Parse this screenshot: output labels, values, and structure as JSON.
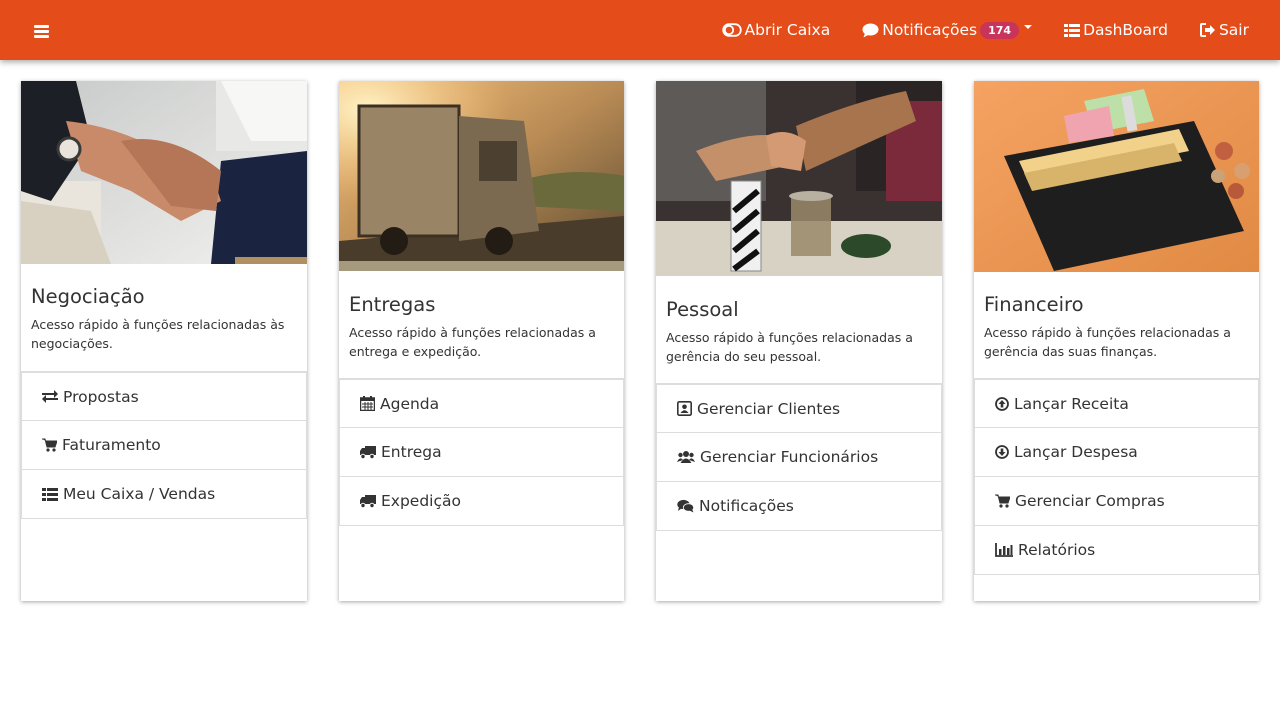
{
  "navbar": {
    "bg_color": "#e44c1a",
    "abrir_caixa": "Abrir Caixa",
    "notificacoes": "Notificações",
    "notif_count": "174",
    "dashboard": "DashBoard",
    "sair": "Sair"
  },
  "cards": [
    {
      "title": "Negociação",
      "text": "Acesso rápido à funções relacionadas às negociações.",
      "image": "handshake-photo",
      "items": [
        {
          "label": "Propostas",
          "icon": "exchange-icon"
        },
        {
          "label": "Faturamento",
          "icon": "cart-icon"
        },
        {
          "label": "Meu Caixa / Vendas",
          "icon": "list-icon"
        }
      ]
    },
    {
      "title": "Entregas",
      "text": "Acesso rápido à funções relacionadas a entrega e expedição.",
      "image": "truck-photo",
      "items": [
        {
          "label": "Agenda",
          "icon": "calendar-icon"
        },
        {
          "label": "Entrega",
          "icon": "truck-icon"
        },
        {
          "label": "Expedição",
          "icon": "truck-icon"
        }
      ]
    },
    {
      "title": "Pessoal",
      "text": "Acesso rápido à funções relacionadas a gerência do seu pessoal.",
      "image": "team-fistbump-photo",
      "items": [
        {
          "label": "Gerenciar Clientes",
          "icon": "contact-book-icon"
        },
        {
          "label": "Gerenciar Funcionários",
          "icon": "users-icon"
        },
        {
          "label": "Notificações",
          "icon": "comments-icon"
        }
      ]
    },
    {
      "title": "Financeiro",
      "text": "Acesso rápido à funções relacionadas a gerência das suas finanças.",
      "image": "wallet-photo",
      "items": [
        {
          "label": "Lançar Receita",
          "icon": "arrow-circle-up-icon"
        },
        {
          "label": "Lançar Despesa",
          "icon": "arrow-circle-down-icon"
        },
        {
          "label": "Gerenciar Compras",
          "icon": "cart-icon"
        },
        {
          "label": "Relatórios",
          "icon": "bar-chart-icon"
        }
      ]
    }
  ]
}
